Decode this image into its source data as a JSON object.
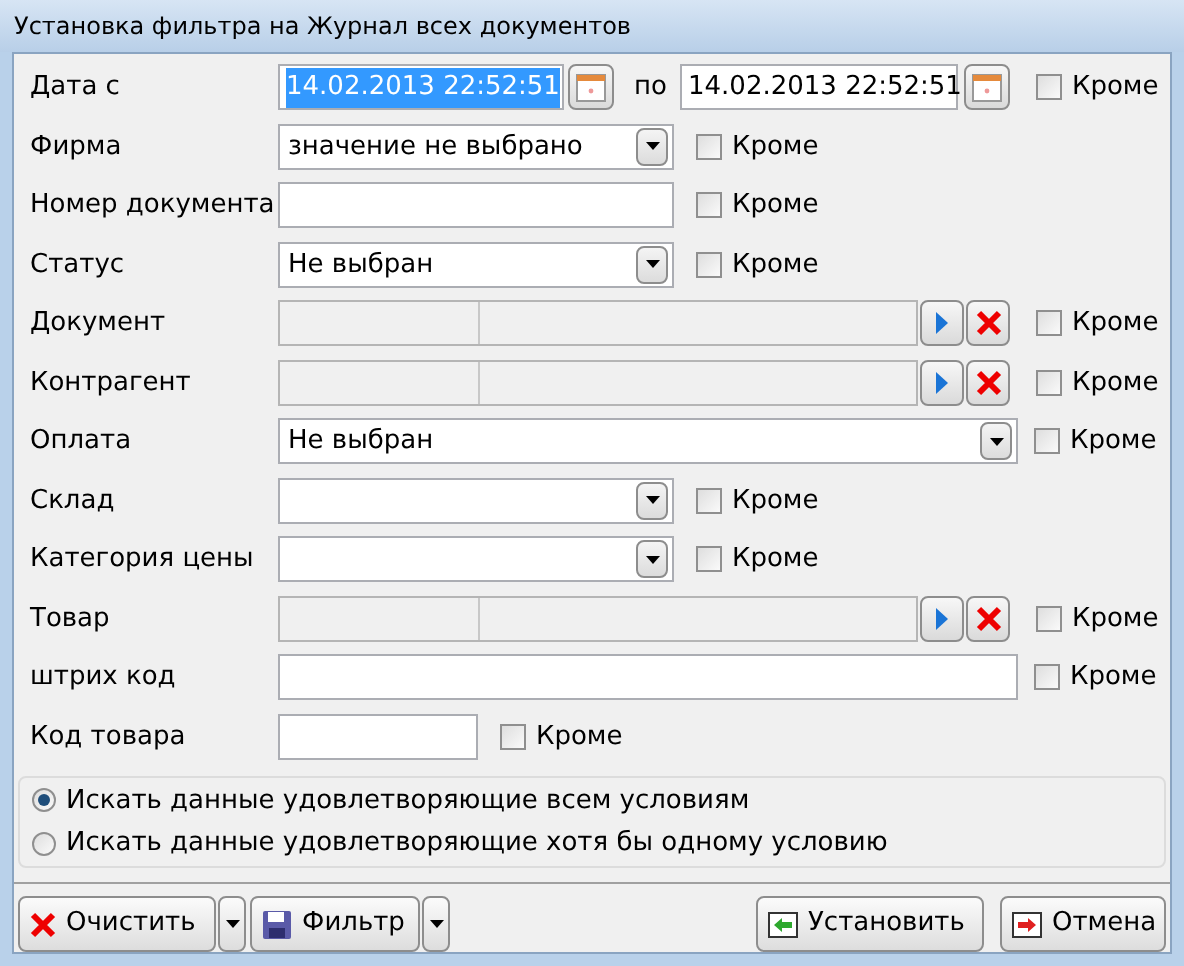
{
  "window": {
    "title": "Установка фильтра на Журнал всех документов"
  },
  "rows": [
    {
      "kind": "date",
      "label": "Дата с",
      "from": "14.02.2013 22:52:51",
      "from_selected": true,
      "to_label": "по",
      "to": "14.02.2013 22:52:51",
      "except": {
        "label": "Кроме",
        "checked": false
      }
    },
    {
      "kind": "select",
      "label": "Фирма",
      "value": "значение не выбрано",
      "except": {
        "label": "Кроме",
        "checked": false
      }
    },
    {
      "kind": "text",
      "label": "Номер документа",
      "except": {
        "label": "Кроме",
        "checked": false
      }
    },
    {
      "kind": "select",
      "label": "Статус",
      "value": "Не выбран",
      "except": {
        "label": "Кроме",
        "checked": false
      }
    },
    {
      "kind": "lookup",
      "label": "Документ",
      "except": {
        "label": "Кроме",
        "checked": false
      }
    },
    {
      "kind": "lookup",
      "label": "Контрагент",
      "except": {
        "label": "Кроме",
        "checked": false
      }
    },
    {
      "kind": "wideselect",
      "label": "Оплата",
      "value": "Не выбран",
      "except": {
        "label": "Кроме",
        "checked": false
      }
    },
    {
      "kind": "select",
      "label": "Склад",
      "except": {
        "label": "Кроме",
        "checked": false
      }
    },
    {
      "kind": "select",
      "label": "Категория цены",
      "except": {
        "label": "Кроме",
        "checked": false
      }
    },
    {
      "kind": "lookup",
      "label": "Товар",
      "except": {
        "label": "Кроме",
        "checked": false
      }
    },
    {
      "kind": "widetext",
      "label": "штрих код",
      "except": {
        "label": "Кроме",
        "checked": false
      }
    },
    {
      "kind": "shorttext",
      "label": "Код товара",
      "except": {
        "label": "Кроме",
        "checked": false
      }
    }
  ],
  "match_mode": [
    {
      "label": "Искать данные удовлетворяющие всем условиям",
      "selected": true
    },
    {
      "label": "Искать данные удовлетворяющие хотя бы одному условию",
      "selected": false
    }
  ],
  "buttons": {
    "clear": "Очистить",
    "filter": "Фильтр",
    "apply": "Установить",
    "cancel": "Отмена"
  }
}
